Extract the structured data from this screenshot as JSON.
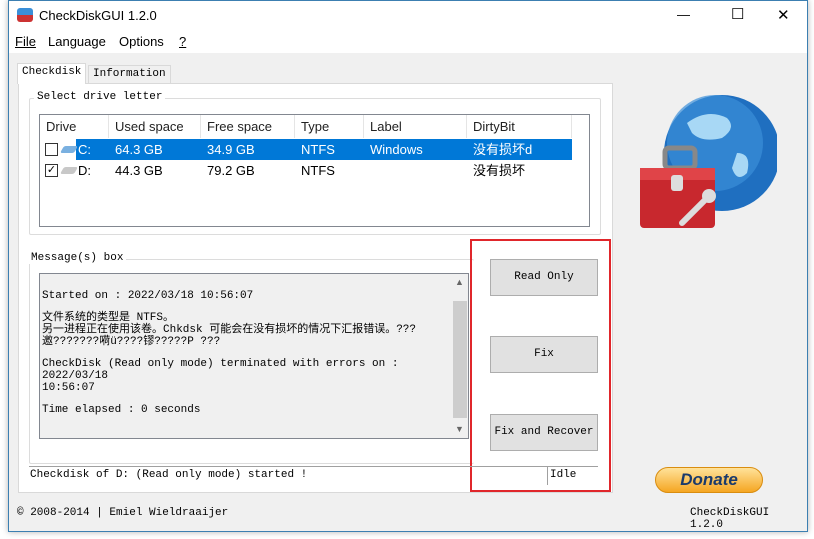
{
  "window": {
    "title": "CheckDiskGUI 1.2.0",
    "minimize": "—",
    "maximize": "☐",
    "close": "✕"
  },
  "menu": [
    "File",
    "Language",
    "Options",
    "?"
  ],
  "tabs": [
    "Checkdisk",
    "Information"
  ],
  "drives_group": {
    "label": "Select drive letter",
    "columns": [
      "Drive",
      "Used space",
      "Free space",
      "Type",
      "Label",
      "DirtyBit"
    ],
    "rows": [
      {
        "checked": false,
        "drive": "C:",
        "used": "64.3 GB",
        "free": "34.9 GB",
        "type": "NTFS",
        "label": "Windows",
        "dirty": "没有损坏d",
        "selected": true
      },
      {
        "checked": true,
        "drive": "D:",
        "used": "44.3 GB",
        "free": "79.2 GB",
        "type": "NTFS",
        "label": "",
        "dirty": "没有损坏",
        "selected": false
      }
    ]
  },
  "messages": {
    "label": "Message(s) box",
    "lines": [
      "Started on : 2022/03/18 10:56:07",
      "文件系统的类型是 NTFS。",
      "另一进程正在使用该卷。Chkdsk 可能会在没有损坏的情况下汇报错误。???",
      "邀???????嗬ü????镠?????P ???",
      "CheckDisk (Read only mode) terminated with errors on : 2022/03/18",
      "10:56:07",
      "Time elapsed : 0 seconds"
    ]
  },
  "buttons": {
    "read_only": "Read Only",
    "fix": "Fix",
    "fix_recover": "Fix and Recover",
    "donate": "Donate"
  },
  "status": {
    "message": "Checkdisk of D: (Read only mode) started !",
    "state": "Idle"
  },
  "footer": {
    "copyright": "© 2008-2014 | Emiel Wieldraaijer",
    "version": "CheckDiskGUI 1.2.0"
  },
  "colors": {
    "selection": "#0078d7",
    "highlight_box": "#e0262b"
  }
}
